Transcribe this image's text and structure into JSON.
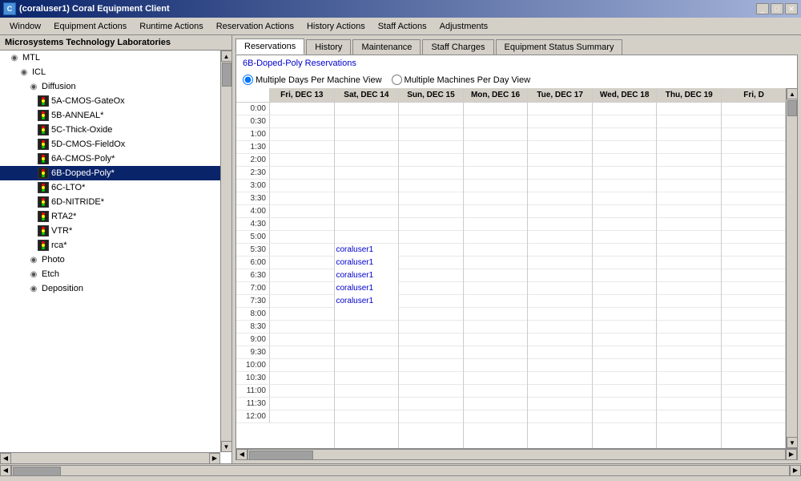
{
  "title_bar": {
    "icon": "C",
    "title": "(coraluser1) Coral Equipment Client",
    "btn_minimize": "_",
    "btn_maximize": "□",
    "btn_close": "✕"
  },
  "menu": {
    "items": [
      "Window",
      "Equipment Actions",
      "Runtime Actions",
      "Reservation Actions",
      "History Actions",
      "Staff Actions",
      "Adjustments"
    ]
  },
  "left_panel": {
    "header": "Microsystems Technology Laboratories",
    "tree": [
      {
        "id": "mtl",
        "label": "MTL",
        "indent": 1,
        "icon": "node"
      },
      {
        "id": "icl",
        "label": "ICL",
        "indent": 2,
        "icon": "node"
      },
      {
        "id": "diffusion",
        "label": "Diffusion",
        "indent": 3,
        "icon": "node"
      },
      {
        "id": "5a",
        "label": "5A-CMOS-GateOx",
        "indent": 4,
        "icon": "traffic"
      },
      {
        "id": "5b",
        "label": "5B-ANNEAL*",
        "indent": 4,
        "icon": "traffic"
      },
      {
        "id": "5c",
        "label": "5C-Thick-Oxide",
        "indent": 4,
        "icon": "traffic"
      },
      {
        "id": "5d",
        "label": "5D-CMOS-FieldOx",
        "indent": 4,
        "icon": "traffic"
      },
      {
        "id": "6a",
        "label": "6A-CMOS-Poly*",
        "indent": 4,
        "icon": "traffic"
      },
      {
        "id": "6b",
        "label": "6B-Doped-Poly*",
        "indent": 4,
        "icon": "traffic",
        "selected": true
      },
      {
        "id": "6c",
        "label": "6C-LTO*",
        "indent": 4,
        "icon": "traffic"
      },
      {
        "id": "6d",
        "label": "6D-NITRIDE*",
        "indent": 4,
        "icon": "traffic"
      },
      {
        "id": "rta2",
        "label": "RTA2*",
        "indent": 4,
        "icon": "traffic"
      },
      {
        "id": "vtr",
        "label": "VTR*",
        "indent": 4,
        "icon": "traffic"
      },
      {
        "id": "rca",
        "label": "rca*",
        "indent": 4,
        "icon": "traffic"
      },
      {
        "id": "photo",
        "label": "Photo",
        "indent": 3,
        "icon": "node"
      },
      {
        "id": "etch",
        "label": "Etch",
        "indent": 3,
        "icon": "node"
      },
      {
        "id": "deposition",
        "label": "Deposition",
        "indent": 3,
        "icon": "node"
      }
    ]
  },
  "tabs": [
    {
      "id": "reservations",
      "label": "Reservations",
      "active": true
    },
    {
      "id": "history",
      "label": "History",
      "active": false
    },
    {
      "id": "maintenance",
      "label": "Maintenance",
      "active": false
    },
    {
      "id": "staff_charges",
      "label": "Staff Charges",
      "active": false
    },
    {
      "id": "equipment_status",
      "label": "Equipment Status Summary",
      "active": false
    }
  ],
  "reservations": {
    "title": "6B-Doped-Poly Reservations",
    "radio_options": [
      {
        "id": "multi_day",
        "label": "Multiple Days Per Machine View",
        "checked": true
      },
      {
        "id": "multi_machine",
        "label": "Multiple Machines Per Day View",
        "checked": false
      }
    ],
    "day_headers": [
      "Fri, DEC 13",
      "Sat, DEC 14",
      "Sun, DEC 15",
      "Mon, DEC 16",
      "Tue, DEC 17",
      "Wed, DEC 18",
      "Thu, DEC 19",
      "Fri, D"
    ],
    "time_slots": [
      "0:00",
      "0:30",
      "1:00",
      "1:30",
      "2:00",
      "2:30",
      "3:00",
      "3:30",
      "4:00",
      "4:30",
      "5:00",
      "5:30",
      "6:00",
      "6:30",
      "7:00",
      "7:30",
      "8:00",
      "8:30",
      "9:00",
      "9:30",
      "10:00",
      "10:30",
      "11:00",
      "11:30",
      "12:00"
    ],
    "reservations": [
      {
        "day_index": 1,
        "time_index": 11,
        "user": "coraluser1"
      },
      {
        "day_index": 1,
        "time_index": 12,
        "user": "coraluser1"
      },
      {
        "day_index": 1,
        "time_index": 13,
        "user": "coraluser1"
      },
      {
        "day_index": 1,
        "time_index": 14,
        "user": "coraluser1"
      },
      {
        "day_index": 1,
        "time_index": 15,
        "user": "coraluser1"
      }
    ]
  }
}
